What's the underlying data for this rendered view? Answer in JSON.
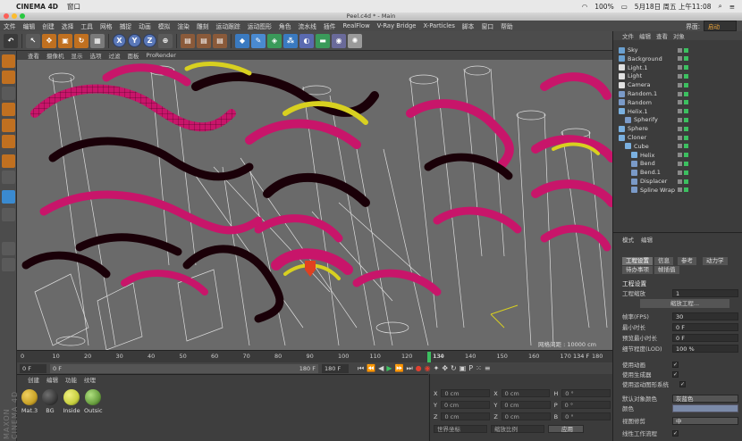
{
  "mac": {
    "app_name": "CINEMA 4D",
    "window_menu": "窗口",
    "clock": "5月18日 周五 上午11:08",
    "battery": "100%"
  },
  "window": {
    "title": "Peel.c4d * - Main"
  },
  "menu": {
    "items": [
      "文件",
      "编辑",
      "创建",
      "选择",
      "工具",
      "网格",
      "捕捉",
      "动画",
      "模拟",
      "渲染",
      "雕刻",
      "运动跟踪",
      "运动图形",
      "角色",
      "流水线",
      "插件",
      "RealFlow",
      "V-Ray Bridge",
      "X-Particles",
      "脚本",
      "窗口",
      "帮助"
    ],
    "layout_label": "界面:",
    "layout_value": "启动"
  },
  "toolbar": {
    "x_label": "X",
    "y_label": "Y",
    "z_label": "Z"
  },
  "viewport": {
    "menu": [
      "查看",
      "摄像机",
      "显示",
      "选项",
      "过滤",
      "面板",
      "ProRender"
    ],
    "grid_label": "网格间距 : 10000 cm",
    "colors": {
      "helix_magenta": "#c8156a",
      "helix_yellow": "#d8d020",
      "background": "#6a6a6a"
    }
  },
  "timeline": {
    "ticks": [
      "0",
      "10",
      "20",
      "30",
      "40",
      "50",
      "60",
      "70",
      "80",
      "90",
      "100",
      "110",
      "120",
      "130",
      "140",
      "150",
      "160",
      "170",
      "180"
    ],
    "current_frame": "134",
    "frame_readout": "134 F"
  },
  "framebar": {
    "start": "0 F",
    "start2": "0 F",
    "end": "180 F",
    "end2": "180 F"
  },
  "materials": {
    "menu": [
      "创建",
      "编辑",
      "功能",
      "纹理"
    ],
    "items": [
      {
        "name": "Mat.3",
        "color": "#c9a227"
      },
      {
        "name": "BG",
        "color": "#3a3a3a"
      },
      {
        "name": "Inside",
        "color": "#c8d040"
      },
      {
        "name": "Outsic",
        "color": "#6aa040"
      }
    ]
  },
  "coords": {
    "rows": [
      {
        "a": "X",
        "av": "0 cm",
        "b": "X",
        "bv": "0 cm",
        "c": "H",
        "cv": "0 °"
      },
      {
        "a": "Y",
        "av": "0 cm",
        "b": "Y",
        "bv": "0 cm",
        "c": "P",
        "cv": "0 °"
      },
      {
        "a": "Z",
        "av": "0 cm",
        "b": "Z",
        "bv": "0 cm",
        "c": "B",
        "cv": "0 °"
      }
    ],
    "mode": "世界坐标",
    "scale_mode": "缩放比例",
    "apply": "应用"
  },
  "objects": {
    "menu": [
      "文件",
      "编辑",
      "查看",
      "对象"
    ],
    "items": [
      {
        "name": "Sky",
        "indent": 0,
        "icon": "#6aa0d0"
      },
      {
        "name": "Background",
        "indent": 0,
        "icon": "#6aa0d0"
      },
      {
        "name": "Light.1",
        "indent": 0,
        "icon": "#e0e0e0"
      },
      {
        "name": "Light",
        "indent": 0,
        "icon": "#e0e0e0"
      },
      {
        "name": "Camera",
        "indent": 0,
        "icon": "#e0e0e0"
      },
      {
        "name": "Random.1",
        "indent": 0,
        "icon": "#7a9ac8"
      },
      {
        "name": "Random",
        "indent": 0,
        "icon": "#7a9ac8"
      },
      {
        "name": "Helix.1",
        "indent": 0,
        "icon": "#7ab0e0"
      },
      {
        "name": "Spherify",
        "indent": 1,
        "icon": "#7a9ac8"
      },
      {
        "name": "Sphere",
        "indent": 0,
        "icon": "#7ab0e0"
      },
      {
        "name": "Cloner",
        "indent": 0,
        "icon": "#7ab0e0"
      },
      {
        "name": "Cube",
        "indent": 1,
        "icon": "#7ab0e0"
      },
      {
        "name": "Helix",
        "indent": 2,
        "icon": "#7ab0e0"
      },
      {
        "name": "Bend",
        "indent": 2,
        "icon": "#7a9ac8"
      },
      {
        "name": "Bend.1",
        "indent": 2,
        "icon": "#7a9ac8"
      },
      {
        "name": "Displacer",
        "indent": 2,
        "icon": "#7a9ac8"
      },
      {
        "name": "Spline Wrap",
        "indent": 2,
        "icon": "#7a9ac8"
      }
    ]
  },
  "attributes": {
    "menu": [
      "模式",
      "编辑"
    ],
    "tabs_row1": [
      "工程设置",
      "信息",
      "参考",
      "动力学"
    ],
    "tabs_row2": [
      "待办事项",
      "帧插值"
    ],
    "section": "工程设置",
    "project_scale_label": "工程缩放",
    "project_scale_value": "1",
    "scale_button": "缩放工程...",
    "rows": [
      {
        "label": "帧率(FPS)",
        "value": "30"
      },
      {
        "label": "最小时长",
        "value": "0 F"
      },
      {
        "label": "预览最小时长",
        "value": "0 F"
      },
      {
        "label": "细节程度(LOD)",
        "value": "100 %"
      }
    ],
    "checks": [
      {
        "label": "使用动画",
        "checked": "✓"
      },
      {
        "label": "使用生成器",
        "checked": "✓"
      },
      {
        "label": "使用运动图形系统",
        "checked": "✓"
      }
    ],
    "default_color_label": "默认对象颜色",
    "default_color_value": "灰蓝色",
    "color_label": "颜色",
    "view_clip_label": "视图修剪",
    "view_clip_value": "中",
    "linear_label": "线性工作流程"
  },
  "branding": "MAXON CINEMA 4D"
}
